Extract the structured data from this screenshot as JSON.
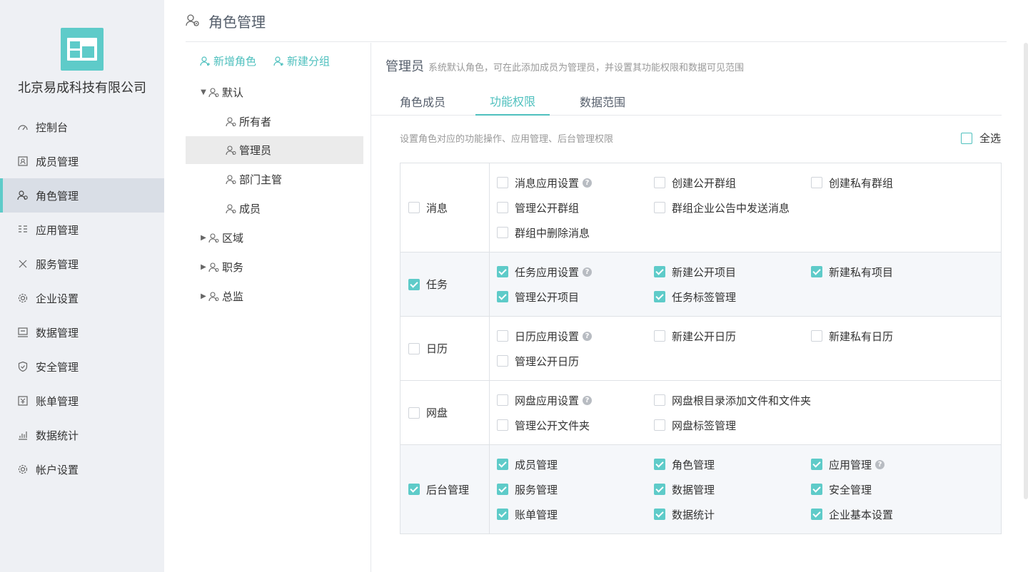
{
  "sidebar": {
    "company": "北京易成科技有限公司",
    "items": [
      {
        "label": "控制台",
        "icon": "dashboard-icon"
      },
      {
        "label": "成员管理",
        "icon": "member-icon"
      },
      {
        "label": "角色管理",
        "icon": "role-icon"
      },
      {
        "label": "应用管理",
        "icon": "app-icon"
      },
      {
        "label": "服务管理",
        "icon": "tools-icon"
      },
      {
        "label": "企业设置",
        "icon": "gear-icon"
      },
      {
        "label": "数据管理",
        "icon": "data-icon"
      },
      {
        "label": "安全管理",
        "icon": "shield-icon"
      },
      {
        "label": "账单管理",
        "icon": "bill-icon"
      },
      {
        "label": "数据统计",
        "icon": "chart-icon"
      },
      {
        "label": "帐户设置",
        "icon": "gear-icon"
      }
    ],
    "active_index": 2
  },
  "header": {
    "title": "角色管理"
  },
  "tree": {
    "add_role": "新增角色",
    "add_group": "新建分组",
    "nodes": [
      {
        "label": "默认",
        "expanded": true
      },
      {
        "label": "所有者"
      },
      {
        "label": "管理员",
        "selected": true
      },
      {
        "label": "部门主管"
      },
      {
        "label": "成员"
      },
      {
        "label": "区域",
        "expanded": false
      },
      {
        "label": "职务",
        "expanded": false
      },
      {
        "label": "总监",
        "expanded": false
      }
    ]
  },
  "main": {
    "role_name": "管理员",
    "role_desc": "系统默认角色，可在此添加成员为管理员，并设置其功能权限和数据可见范围",
    "tabs": [
      "角色成员",
      "功能权限",
      "数据范围"
    ],
    "active_tab": 1,
    "perm_desc": "设置角色对应的功能操作、应用管理、后台管理权限",
    "select_all": "全选"
  },
  "permissions": [
    {
      "category": "消息",
      "checked": false,
      "items": [
        {
          "label": "消息应用设置",
          "checked": false,
          "help": true
        },
        {
          "label": "创建公开群组",
          "checked": false
        },
        {
          "label": "创建私有群组",
          "checked": false
        },
        {
          "label": "管理公开群组",
          "checked": false
        },
        {
          "label": "群组企业公告中发送消息",
          "checked": false
        },
        {
          "label": "",
          "checked": false,
          "blank": true
        },
        {
          "label": "群组中删除消息",
          "checked": false
        }
      ]
    },
    {
      "category": "任务",
      "checked": true,
      "items": [
        {
          "label": "任务应用设置",
          "checked": true,
          "help": true
        },
        {
          "label": "新建公开项目",
          "checked": true
        },
        {
          "label": "新建私有项目",
          "checked": true
        },
        {
          "label": "管理公开项目",
          "checked": true
        },
        {
          "label": "任务标签管理",
          "checked": true
        }
      ]
    },
    {
      "category": "日历",
      "checked": false,
      "items": [
        {
          "label": "日历应用设置",
          "checked": false,
          "help": true
        },
        {
          "label": "新建公开日历",
          "checked": false
        },
        {
          "label": "新建私有日历",
          "checked": false
        },
        {
          "label": "管理公开日历",
          "checked": false
        }
      ]
    },
    {
      "category": "网盘",
      "checked": false,
      "items": [
        {
          "label": "网盘应用设置",
          "checked": false,
          "help": true
        },
        {
          "label": "网盘根目录添加文件和文件夹",
          "checked": false
        },
        {
          "label": "",
          "checked": false,
          "blank": true
        },
        {
          "label": "管理公开文件夹",
          "checked": false
        },
        {
          "label": "网盘标签管理",
          "checked": false
        }
      ]
    },
    {
      "category": "后台管理",
      "checked": true,
      "items": [
        {
          "label": "成员管理",
          "checked": true
        },
        {
          "label": "角色管理",
          "checked": true
        },
        {
          "label": "应用管理",
          "checked": true,
          "help": true
        },
        {
          "label": "服务管理",
          "checked": true
        },
        {
          "label": "数据管理",
          "checked": true
        },
        {
          "label": "安全管理",
          "checked": true
        },
        {
          "label": "账单管理",
          "checked": true
        },
        {
          "label": "数据统计",
          "checked": true
        },
        {
          "label": "企业基本设置",
          "checked": true
        }
      ]
    }
  ],
  "colors": {
    "accent": "#5ecbc9",
    "sidebar_bg": "#eef0f4",
    "active_bg": "#d9dee6"
  }
}
